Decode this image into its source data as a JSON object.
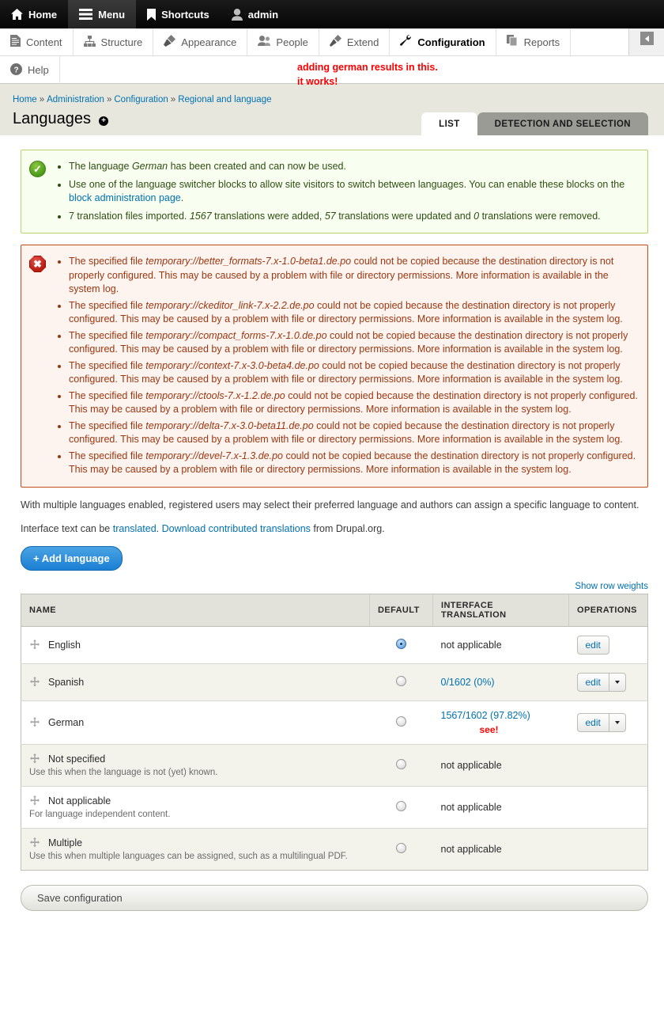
{
  "toolbar": {
    "top_items": [
      {
        "label": "Home",
        "icon": "home-icon",
        "active": false
      },
      {
        "label": "Menu",
        "icon": "hamburger-icon",
        "active": true
      },
      {
        "label": "Shortcuts",
        "icon": "bookmark-icon",
        "active": false
      },
      {
        "label": "admin",
        "icon": "user-icon",
        "active": false
      }
    ],
    "menu_items": [
      {
        "label": "Content",
        "icon": "document-icon"
      },
      {
        "label": "Structure",
        "icon": "sitemap-icon"
      },
      {
        "label": "Appearance",
        "icon": "paintbrush-icon"
      },
      {
        "label": "People",
        "icon": "people-icon"
      },
      {
        "label": "Extend",
        "icon": "plug-icon"
      },
      {
        "label": "Configuration",
        "icon": "wrench-icon"
      },
      {
        "label": "Reports",
        "icon": "reports-icon"
      }
    ],
    "help_item": {
      "label": "Help",
      "icon": "question-mark-icon"
    }
  },
  "annotations": {
    "toolbar_line1": "adding german results in this.",
    "toolbar_line2": "it works!",
    "german_see": "see!",
    "color": "#ff0000"
  },
  "breadcrumb": {
    "items": [
      "Home",
      "Administration",
      "Configuration",
      "Regional and language"
    ],
    "separator": "»"
  },
  "page": {
    "title": "Languages",
    "title_icon": "add-circle-icon"
  },
  "tabs": [
    {
      "label": "LIST",
      "selected": true
    },
    {
      "label": "DETECTION AND SELECTION",
      "selected": false
    }
  ],
  "status_message": {
    "icon": "check-circle-icon",
    "items": [
      {
        "parts": [
          {
            "t": "The language "
          },
          {
            "t": "German",
            "em": true
          },
          {
            "t": " has been created and can now be used."
          }
        ]
      },
      {
        "parts": [
          {
            "t": "Use one of the language switcher blocks to allow site visitors to switch between languages. You can enable these blocks on the "
          },
          {
            "t": "block administration page",
            "link": true
          },
          {
            "t": "."
          }
        ]
      },
      {
        "parts": [
          {
            "t": "7 translation files imported. "
          },
          {
            "t": "1567",
            "em": true
          },
          {
            "t": " translations were added, "
          },
          {
            "t": "57",
            "em": true
          },
          {
            "t": " translations were updated and "
          },
          {
            "t": "0",
            "em": true
          },
          {
            "t": " translations were removed."
          }
        ]
      }
    ]
  },
  "error_message": {
    "icon": "error-octagon-icon",
    "prefix": "The specified file ",
    "suffix_a": " could not be copied because the destination directory is not properly configured. This may be caused by a problem with file or directory permissions. More information is available in the system log.",
    "files": [
      "temporary://better_formats-7.x-1.0-beta1.de.po",
      "temporary://ckeditor_link-7.x-2.2.de.po",
      "temporary://compact_forms-7.x-1.0.de.po",
      "temporary://context-7.x-3.0-beta4.de.po",
      "temporary://ctools-7.x-1.2.de.po",
      "temporary://delta-7.x-3.0-beta11.de.po",
      "temporary://devel-7.x-1.3.de.po"
    ]
  },
  "intro": {
    "paragraph1": "With multiple languages enabled, registered users may select their preferred language and authors can assign a specific language to content.",
    "p2_pre": "Interface text can be ",
    "p2_link1": "translated",
    "p2_mid": ". ",
    "p2_link2": "Download contributed translations",
    "p2_post": " from Drupal.org."
  },
  "add_language_button": "+ Add language",
  "show_row_weights": "Show row weights",
  "table": {
    "headers": [
      "NAME",
      "DEFAULT",
      "INTERFACE TRANSLATION",
      "OPERATIONS"
    ],
    "rows": [
      {
        "name": "English",
        "desc": "",
        "default_selected": true,
        "translation": "not applicable",
        "translation_link": false,
        "ops_edit": "edit",
        "has_dropdown": false,
        "annotation": ""
      },
      {
        "name": "Spanish",
        "desc": "",
        "default_selected": false,
        "translation": "0/1602 (0%)",
        "translation_link": true,
        "ops_edit": "edit",
        "has_dropdown": true,
        "annotation": ""
      },
      {
        "name": "German",
        "desc": "",
        "default_selected": false,
        "translation": "1567/1602 (97.82%)",
        "translation_link": true,
        "ops_edit": "edit",
        "has_dropdown": true,
        "annotation": "see!"
      },
      {
        "name": "Not specified",
        "desc": "Use this when the language is not (yet) known.",
        "default_selected": false,
        "translation": "not applicable",
        "translation_link": false,
        "ops_edit": "",
        "has_dropdown": false,
        "annotation": ""
      },
      {
        "name": "Not applicable",
        "desc": "For language independent content.",
        "default_selected": false,
        "translation": "not applicable",
        "translation_link": false,
        "ops_edit": "",
        "has_dropdown": false,
        "annotation": ""
      },
      {
        "name": "Multiple",
        "desc": "Use this when multiple languages can be assigned, such as a multilingual PDF.",
        "default_selected": false,
        "translation": "not applicable",
        "translation_link": false,
        "ops_edit": "",
        "has_dropdown": false,
        "annotation": ""
      }
    ]
  },
  "save_button": "Save configuration",
  "colors": {
    "link": "#0071b3",
    "accent_blue": "#1b7fd4",
    "status_bg": "#f8fff0",
    "error_bg": "#fdf4ef",
    "page_head_bg": "#e8e7dd"
  }
}
